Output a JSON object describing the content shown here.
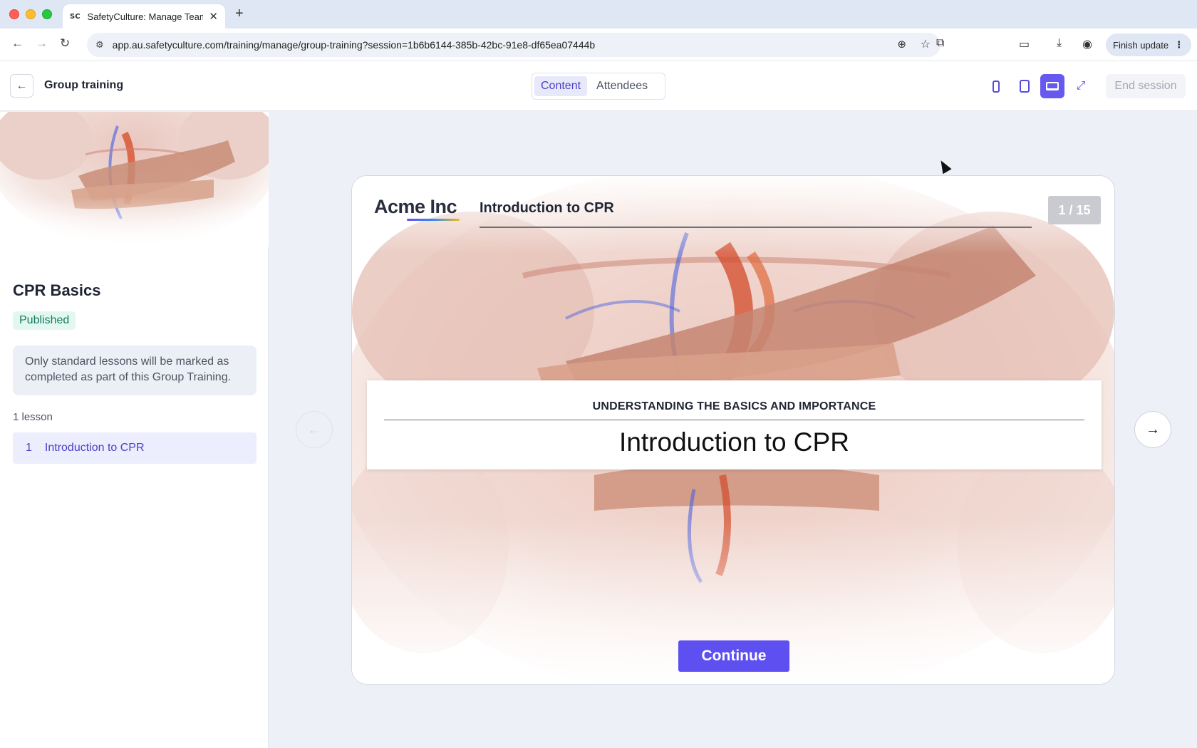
{
  "browser": {
    "tab_favicon": "SC",
    "tab_title": "SafetyCulture: Manage Teams",
    "url": "app.au.safetyculture.com/training/manage/group-training?session=1b6b6144-385b-42bc-91e8-df65ea07444b",
    "finish_update": "Finish update"
  },
  "header": {
    "title": "Group training",
    "tabs": [
      {
        "label": "Content",
        "active": true
      },
      {
        "label": "Attendees",
        "active": false
      }
    ],
    "end_session": "End session"
  },
  "sidebar": {
    "course_title": "CPR Basics",
    "status_badge": "Published",
    "note": "Only standard lessons will be marked as completed as part of this Group Training.",
    "lesson_count": "1 lesson",
    "lessons": [
      {
        "number": "1",
        "title": "Introduction to CPR"
      }
    ]
  },
  "slide": {
    "brand": "Acme Inc",
    "header_title": "Introduction to CPR",
    "page_counter": "1 / 15",
    "subtitle": "UNDERSTANDING THE BASICS AND IMPORTANCE",
    "title": "Introduction to CPR",
    "continue_label": "Continue"
  },
  "colors": {
    "accent": "#5e4ff0",
    "badge_bg": "#e3f7f1",
    "badge_text": "#127a5e",
    "stage_bg": "#eef0f8"
  }
}
